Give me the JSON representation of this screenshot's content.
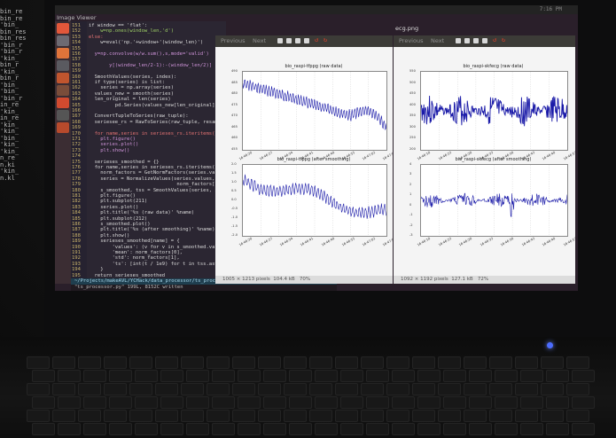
{
  "desktop": {
    "left_window_title": "Image Viewer",
    "right_window_title": "ecg.png",
    "clock": "7:16 PM"
  },
  "terminal_strip": {
    "lines": [
      "bin_re",
      "bin_re",
      "'bin_",
      "bin_res",
      "bin_res",
      "'bin_r",
      "'bin_r",
      "'kin_",
      "bin_r",
      "'kin_",
      "bin_r",
      "'bin_",
      "'bin_",
      "'bin_r",
      "in_re",
      "'kin_",
      "in_re",
      "'kin_",
      "'kin_",
      "'bin_",
      "'kin_",
      "'kin_",
      "n_re",
      "n.ki",
      "'kin_",
      "n.kl"
    ]
  },
  "editor": {
    "line_numbers": [
      "151",
      "152",
      "153",
      "154",
      "155",
      "156",
      "157",
      "158",
      "159",
      "160",
      "161",
      "162",
      "163",
      "164",
      "165",
      "166",
      "167",
      "168",
      "169",
      "170",
      "171",
      "172",
      "173",
      "174",
      "175",
      "176",
      "177",
      "178",
      "179",
      "180",
      "181",
      "182",
      "183",
      "184",
      "185",
      "186",
      "187",
      "188",
      "189",
      "190",
      "191",
      "192",
      "193",
      "194",
      "195"
    ],
    "code": [
      {
        "t": "if window == 'flat':",
        "c": "#d9d9d9"
      },
      {
        "t": "    w=np.ones(window_len,'d')",
        "c": "#9ccc65"
      },
      {
        "t": "else:",
        "c": "#e57373"
      },
      {
        "t": "    w=eval('np.'+window+'(window_len)')",
        "c": "#d9d9d9"
      },
      {
        "t": "",
        "c": "#d9d9d9"
      },
      {
        "t": "  y=np.convolve(w/w.sum(),s,mode='valid')",
        "c": "#ce93d8"
      },
      {
        "t": "",
        "c": "#d9d9d9"
      },
      {
        "t": "       y[(window_len/2-1):-(window_len/2)]",
        "c": "#ce93d8"
      },
      {
        "t": "",
        "c": "#d9d9d9"
      },
      {
        "t": "  SmoothValues(series, index):",
        "c": "#d9d9d9"
      },
      {
        "t": "  if type(series) is list:",
        "c": "#d9d9d9"
      },
      {
        "t": "    series = np.array(series)",
        "c": "#d9d9d9"
      },
      {
        "t": "  values_new = smooth(series)",
        "c": "#d9d9d9"
      },
      {
        "t": "  len_original = len(series)",
        "c": "#d9d9d9"
      },
      {
        "t": "         pd.Series(values_new[len_original], index",
        "c": "#d9d9d9"
      },
      {
        "t": "",
        "c": "#d9d9d9"
      },
      {
        "t": "  ConvertTupleToSeries(raw_tuple):",
        "c": "#d9d9d9"
      },
      {
        "t": "  seriesee_rs = RawToSeries(raw_tuple, resample_goo",
        "c": "#d9d9d9"
      },
      {
        "t": "",
        "c": "#d9d9d9"
      },
      {
        "t": "  for name,series in serieses_rs.iteritems():",
        "c": "#e57373"
      },
      {
        "t": "    plt.figure()",
        "c": "#ce93d8"
      },
      {
        "t": "    series.plot()",
        "c": "#ce93d8"
      },
      {
        "t": "    plt.show()",
        "c": "#ce93d8"
      },
      {
        "t": "",
        "c": "#d9d9d9"
      },
      {
        "t": "  serieses_smoothed = {}",
        "c": "#d9d9d9"
      },
      {
        "t": "  for name,series in serieses_rs.iteritems():",
        "c": "#d9d9d9"
      },
      {
        "t": "    norm_factors = GetNormFactors(series.values)",
        "c": "#d9d9d9"
      },
      {
        "t": "    series = NormalizeValues(series.values, norm",
        "c": "#d9d9d9"
      },
      {
        "t": "                              norm_factors[1])",
        "c": "#d9d9d9"
      },
      {
        "t": "    s_smoothed, tss = SmoothValues(series, series.",
        "c": "#d9d9d9"
      },
      {
        "t": "    plt.figure()",
        "c": "#d9d9d9"
      },
      {
        "t": "    plt.subplot(211)",
        "c": "#d9d9d9"
      },
      {
        "t": "    series.plot()",
        "c": "#d9d9d9"
      },
      {
        "t": "    plt.title('%s (raw data)' %name)",
        "c": "#d9d9d9"
      },
      {
        "t": "    plt.subplot(212)",
        "c": "#d9d9d9"
      },
      {
        "t": "    s_smoothed.plot()",
        "c": "#d9d9d9"
      },
      {
        "t": "    plt.title('%s (after smoothing)' %name)",
        "c": "#d9d9d9"
      },
      {
        "t": "    plt.show()",
        "c": "#d9d9d9"
      },
      {
        "t": "    serieses_smoothed[name] = {",
        "c": "#d9d9d9"
      },
      {
        "t": "        'values': (v for v in s_smoothed.values),",
        "c": "#d9d9d9"
      },
      {
        "t": "        'mean': norm_factors[0],",
        "c": "#d9d9d9"
      },
      {
        "t": "        'std': norm_factors[1],",
        "c": "#d9d9d9"
      },
      {
        "t": "        'ts': [int(t / 1e9) for t in tss.astype(np.int64",
        "c": "#d9d9d9"
      },
      {
        "t": "    }",
        "c": "#d9d9d9"
      },
      {
        "t": "  return serieses_smoothed",
        "c": "#d9d9d9"
      }
    ],
    "status_line": "~/Projects/makeAVL/YCHack/data_processor/ts_processor.py",
    "command_line": "\"ts_processor.py\" 199L, 8152C written"
  },
  "viewer_left": {
    "prev": "Previous",
    "next": "Next",
    "status": "1005 × 1213 pixels  104.4 kB   70%",
    "charts": [
      {
        "title": "bio_raspi-tfppg (raw data)",
        "yticks": [
          "490",
          "485",
          "480",
          "475",
          "470",
          "465",
          "460",
          "455"
        ],
        "xticks": [
          "16:46:20",
          "16:46:27",
          "16:46:34",
          "16:46:41",
          "16:46:48",
          "16:46:55",
          "16:47:02",
          "16:47:09"
        ]
      },
      {
        "title": "bio_raspi-tfppg (after smoothing)",
        "yticks": [
          "2.0",
          "1.5",
          "1.0",
          "0.5",
          "0.0",
          "-0.5",
          "-1.0",
          "-1.5",
          "-2.0"
        ],
        "xticks": [
          "16:46:20",
          "16:46:27",
          "16:46:34",
          "16:46:41",
          "16:46:48",
          "16:46:55",
          "16:47:02",
          "16:47:09"
        ]
      }
    ]
  },
  "viewer_right": {
    "prev": "Previous",
    "next": "Next",
    "status": "1092 × 1192 pixels  127.1 kB   72%",
    "charts": [
      {
        "title": "bio_raspi-skfecg (raw data)",
        "yticks": [
          "550",
          "500",
          "450",
          "400",
          "350",
          "300",
          "250",
          "200"
        ],
        "xticks": [
          "16:46:18",
          "16:46:23",
          "16:46:28",
          "16:46:33",
          "16:46:38",
          "16:46:43",
          "16:46:48",
          "16:46:53"
        ]
      },
      {
        "title": "bio_raspi-skfecg (after smoothing)",
        "yticks": [
          "4",
          "3",
          "2",
          "1",
          "0",
          "-1",
          "-2",
          "-3"
        ],
        "xticks": [
          "16:46:18",
          "16:46:23",
          "16:46:28",
          "16:46:33",
          "16:46:38",
          "16:46:43",
          "16:46:48",
          "16:46:53"
        ]
      }
    ]
  }
}
